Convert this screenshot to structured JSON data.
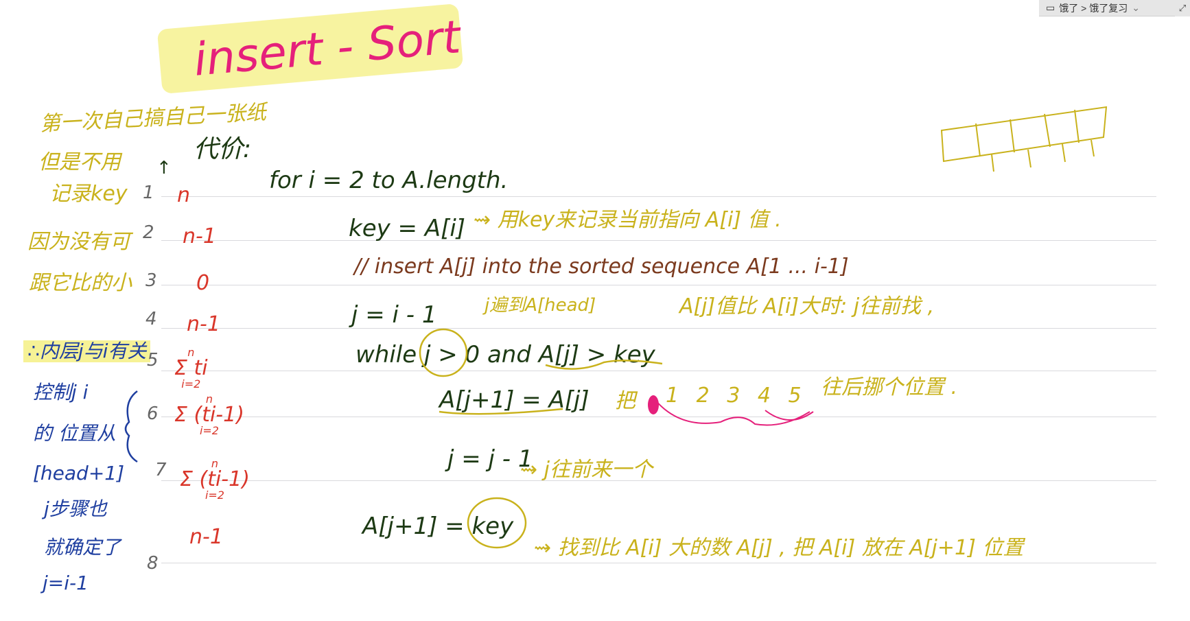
{
  "breadcrumb": {
    "icon": "notebook-icon",
    "path": "饿了 > 饿了复习",
    "chevron": "⌄",
    "corner": "⤢"
  },
  "title": "insert - Sort",
  "left_notes": {
    "top": "第一次自己搞自己一张纸",
    "key_note_1": "但是不用",
    "key_note_2": "记录key",
    "key_note_3": "因为没有可",
    "key_note_4": "跟它比的小",
    "inner_1": "∴内层j与i有关",
    "inner_2": "控制j i",
    "inner_3": "的 位置从",
    "inner_4": "[head+1]",
    "inner_5": "j步骤也",
    "inner_6": "就确定了",
    "inner_7": "j=i-1"
  },
  "cost_header": "代价:",
  "arrow_up": "↑",
  "line_numbers": [
    "1",
    "2",
    "3",
    "4",
    "5",
    "6",
    "7",
    "8"
  ],
  "costs": [
    "n",
    "n-1",
    "0",
    "n-1",
    "Σ ti",
    "Σ (ti-1)",
    "Σ (ti-1)",
    "n-1"
  ],
  "sum_upper": "n",
  "sum_lower": "i=2",
  "code": [
    "for  i = 2   to   A.length.",
    "key = A[i]",
    "// insert A[j] into the sorted sequence  A[1 ... i-1]",
    "j = i - 1",
    "while  j > 0   and A[j] > key",
    "A[j+1] = A[j]",
    "j = j - 1",
    "A[j+1] =  key"
  ],
  "annotations": {
    "a_key": "⇝ 用key来记录当前指向 A[i] 值 .",
    "a_j": "j遍到A[head]",
    "a_while": "A[j]值比 A[i]大时: j往前找 ,",
    "a_shift_1": "把",
    "a_shift_2": "1 2 3 4 5",
    "a_shift_3": "往后挪个位置 .",
    "a_jdec": "⇝ j往前来一个",
    "a_final": "⇝ 找到比 A[i] 大的数 A[j] , 把 A[i] 放在 A[j+1] 位置"
  },
  "colors": {
    "code": "#1d3a14",
    "tan": "#c9b21c",
    "brown": "#7b3a1e",
    "red": "#d9362a",
    "blue": "#1f3fa0",
    "pink": "#e5207b",
    "highlight": "#f6f296"
  }
}
